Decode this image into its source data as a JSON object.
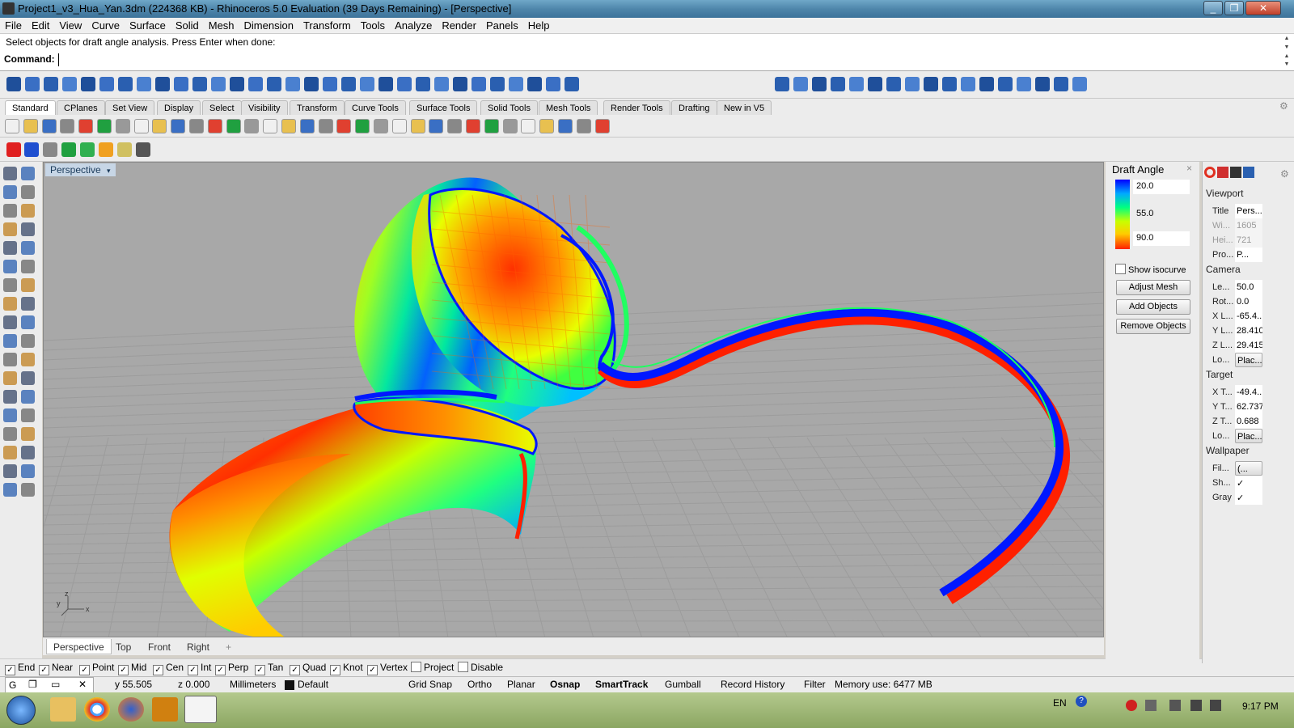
{
  "window": {
    "title": "Project1_v3_Hua_Yan.3dm (224368 KB) - Rhinoceros 5.0 Evaluation (39 Days Remaining) - [Perspective]",
    "min": "_",
    "max": "❐",
    "close": "✕"
  },
  "menu": [
    "File",
    "Edit",
    "View",
    "Curve",
    "Surface",
    "Solid",
    "Mesh",
    "Dimension",
    "Transform",
    "Tools",
    "Analyze",
    "Render",
    "Panels",
    "Help"
  ],
  "command": {
    "prompt": "Select objects for draft angle analysis. Press Enter when done:",
    "label": "Command:",
    "value": ""
  },
  "tabs": [
    "Standard",
    "CPlanes",
    "Set View",
    "Display",
    "Select",
    "Visibility",
    "Transform",
    "Curve Tools",
    "Surface Tools",
    "Solid Tools",
    "Mesh Tools",
    "Render Tools",
    "Drafting",
    "New in V5"
  ],
  "viewport": {
    "label": "Perspective",
    "tabs": [
      "Perspective",
      "Top",
      "Front",
      "Right"
    ],
    "add_tab": "+"
  },
  "draft_panel": {
    "title": "Draft Angle",
    "close": "×",
    "min_value": "20.0",
    "mid_value": "55.0",
    "max_value": "90.0",
    "show_isocurve": "Show isocurve",
    "show_isocurve_checked": false,
    "buttons": [
      "Adjust Mesh",
      "Add Objects",
      "Remove Objects"
    ]
  },
  "properties": {
    "viewport_section": "Viewport",
    "viewport_rows": [
      {
        "k": "Title",
        "v": "Pers..."
      },
      {
        "k": "Wi...",
        "v": "1605"
      },
      {
        "k": "Hei...",
        "v": "721"
      },
      {
        "k": "Pro...",
        "v": "P..."
      }
    ],
    "camera_section": "Camera",
    "camera_rows": [
      {
        "k": "Le...",
        "v": "50.0"
      },
      {
        "k": "Rot...",
        "v": "0.0"
      },
      {
        "k": "X L...",
        "v": "-65.4..."
      },
      {
        "k": "Y L...",
        "v": "28.410"
      },
      {
        "k": "Z L...",
        "v": "29.415"
      },
      {
        "k": "Lo...",
        "v": "Plac..."
      }
    ],
    "target_section": "Target",
    "target_rows": [
      {
        "k": "X T...",
        "v": "-49.4..."
      },
      {
        "k": "Y T...",
        "v": "62.737"
      },
      {
        "k": "Z T...",
        "v": "0.688"
      },
      {
        "k": "Lo...",
        "v": "Plac..."
      }
    ],
    "wallpaper_section": "Wallpaper",
    "wallpaper_rows": [
      {
        "k": "Fil...",
        "v": "(..."
      },
      {
        "k": "Sh...",
        "v": "✓"
      },
      {
        "k": "Gray",
        "v": "✓"
      }
    ]
  },
  "osnap": [
    {
      "label": "End",
      "checked": true
    },
    {
      "label": "Near",
      "checked": true
    },
    {
      "label": "Point",
      "checked": true
    },
    {
      "label": "Mid",
      "checked": true
    },
    {
      "label": "Cen",
      "checked": true
    },
    {
      "label": "Int",
      "checked": true
    },
    {
      "label": "Perp",
      "checked": true
    },
    {
      "label": "Tan",
      "checked": true
    },
    {
      "label": "Quad",
      "checked": true
    },
    {
      "label": "Knot",
      "checked": true
    },
    {
      "label": "Vertex",
      "checked": true
    },
    {
      "label": "Project",
      "checked": false
    },
    {
      "label": "Disable",
      "checked": false
    }
  ],
  "status": {
    "y": "y 55.505",
    "z": "z 0.000",
    "units": "Millimeters",
    "layer": "Default",
    "grid_snap": "Grid Snap",
    "ortho": "Ortho",
    "planar": "Planar",
    "osnap": "Osnap",
    "smarttrack": "SmartTrack",
    "gumball": "Gumball",
    "record_history": "Record History",
    "filter": "Filter",
    "memory": "Memory use: 6477 MB",
    "cplane_label": "G"
  },
  "taskbar": {
    "lang": "EN",
    "time": "9:17 PM"
  },
  "axes": {
    "x": "x",
    "y": "y",
    "z": "z"
  },
  "colors": {
    "viewport_bg": "#a8a8a8",
    "grid": "#9a9a9a",
    "red": "#ff2000",
    "orange": "#ff9a00",
    "yellow": "#e8ff00",
    "green": "#20ff60",
    "cyan": "#00c8ff",
    "blue": "#0010ff"
  }
}
